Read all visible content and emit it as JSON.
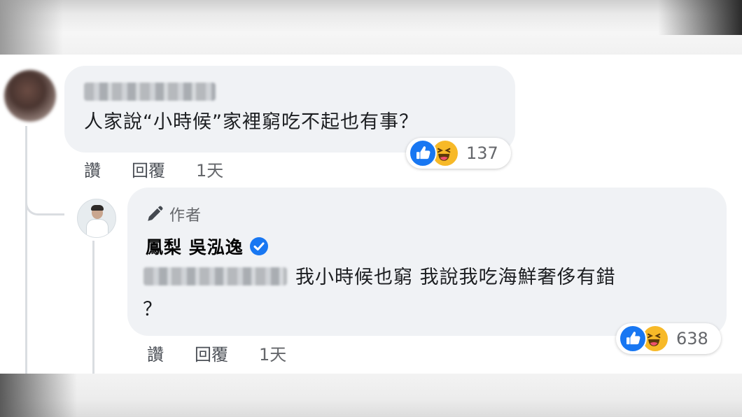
{
  "colors": {
    "bubble": "#f0f2f5",
    "like": "#1877f2",
    "haha": "#f7b928",
    "verified": "#1877f2",
    "secondary_text": "#65676b"
  },
  "comment1": {
    "text": "人家說“小時候”家裡窮吃不起也有事？",
    "actions": {
      "like": "讚",
      "reply": "回覆",
      "time": "1天"
    },
    "reaction_count": "137"
  },
  "comment2": {
    "author_label": "作者",
    "author_name": "鳳梨 吳泓逸",
    "text_line1": "我小時候也窮 我說我吃海鮮奢侈有錯",
    "text_line2": "？",
    "actions": {
      "like": "讚",
      "reply": "回覆",
      "time": "1天"
    },
    "reaction_count": "638"
  },
  "icons": {
    "pencil": "pencil-icon",
    "verified": "verified-badge-icon",
    "like": "like-reaction-icon",
    "haha": "haha-reaction-icon"
  }
}
